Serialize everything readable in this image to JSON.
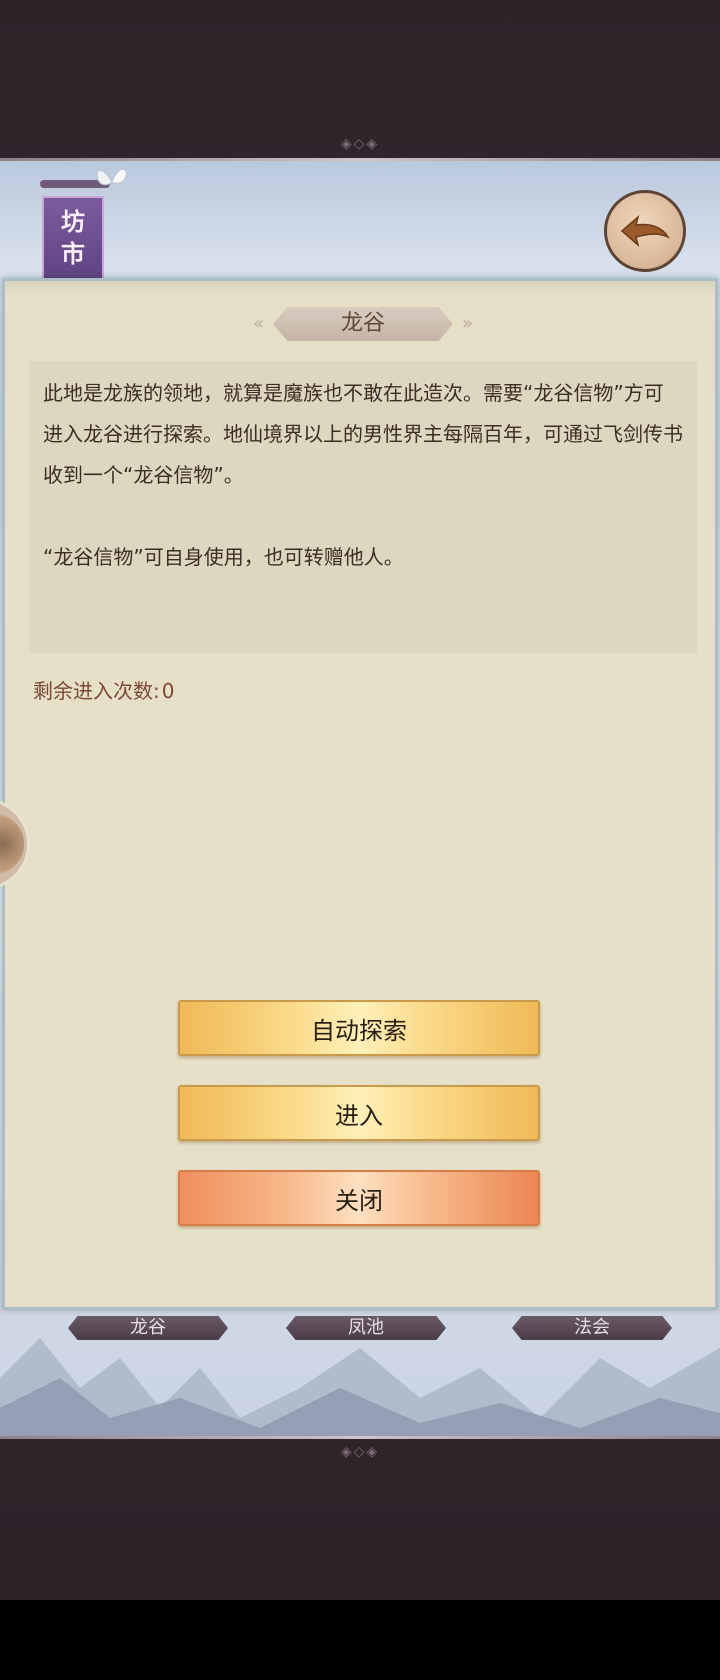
{
  "banner": {
    "line1": "坊",
    "line2": "市"
  },
  "dialog": {
    "title": "龙谷",
    "description_1": "此地是龙族的领地，就算是魔族也不敢在此造次。需要“龙谷信物”方可进入龙谷进行探索。地仙境界以上的男性界主每隔百年，可通过飞剑传书收到一个“龙谷信物”。",
    "description_2": "“龙谷信物”可自身使用，也可转赠他人。",
    "remaining_label": "剩余进入次数:",
    "remaining_value": "0",
    "buttons": {
      "auto_explore": "自动探索",
      "enter": "进入",
      "close": "关闭"
    }
  },
  "tabs": [
    "龙谷",
    "凤池",
    "法会"
  ],
  "colors": {
    "panel_bg": "#e6e0c8",
    "button_gold": "#f5c86a",
    "button_orange": "#f2a070",
    "banner_purple": "#6a4e8e"
  },
  "icons": {
    "back": "back-arrow-icon",
    "side_handle": "side-menu-handle-icon"
  }
}
